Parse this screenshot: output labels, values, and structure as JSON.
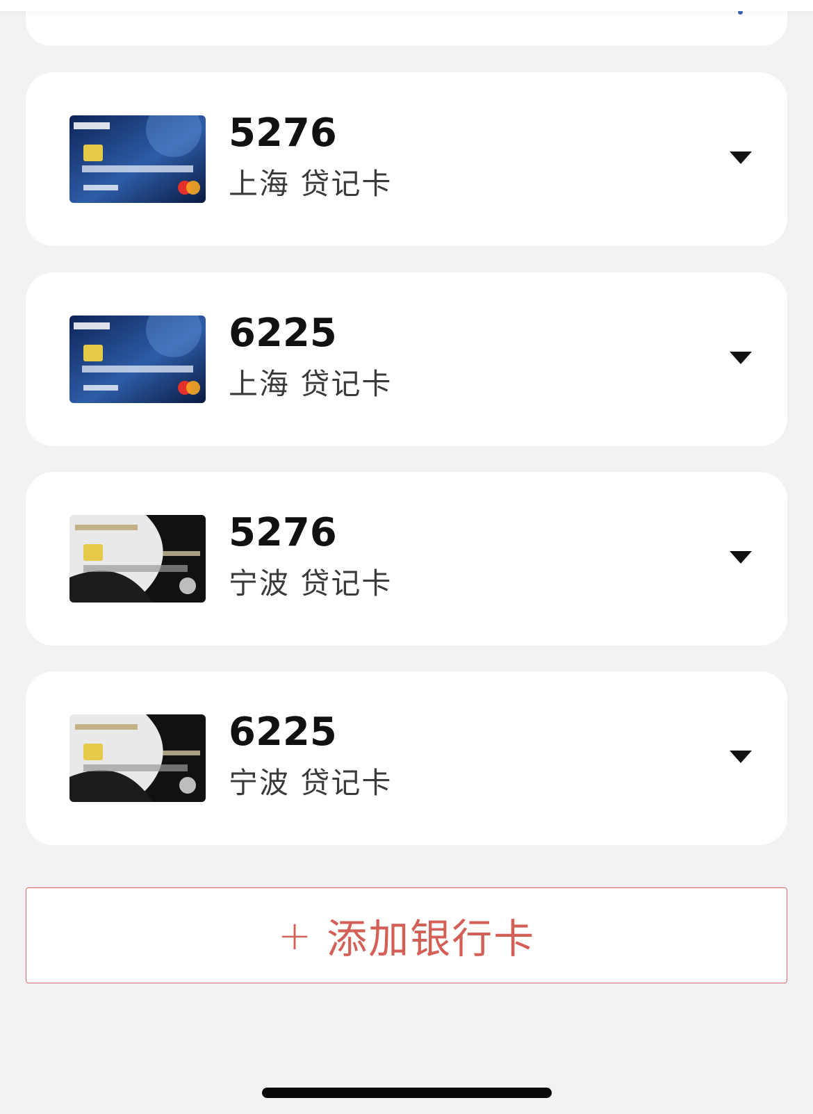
{
  "top_partial": {
    "left_label": "",
    "right_label": ""
  },
  "cards": [
    {
      "number": "5276",
      "description": "上海 贷记卡",
      "card_style": "icbc-global-travel-blue"
    },
    {
      "number": "6225",
      "description": "上海 贷记卡",
      "card_style": "icbc-global-travel-blue"
    },
    {
      "number": "5276",
      "description": "宁波 贷记卡",
      "card_style": "icbc-shangri-la-platinum"
    },
    {
      "number": "6225",
      "description": "宁波 贷记卡",
      "card_style": "icbc-shangri-la-platinum"
    }
  ],
  "add_button": {
    "plus": "+",
    "label": "添加银行卡"
  },
  "colors": {
    "accent_red": "#d35f56",
    "link_blue": "#3e63b6",
    "background": "#f2f2f4"
  },
  "icons": {
    "expand": "caret-down-icon",
    "add": "plus-icon"
  }
}
